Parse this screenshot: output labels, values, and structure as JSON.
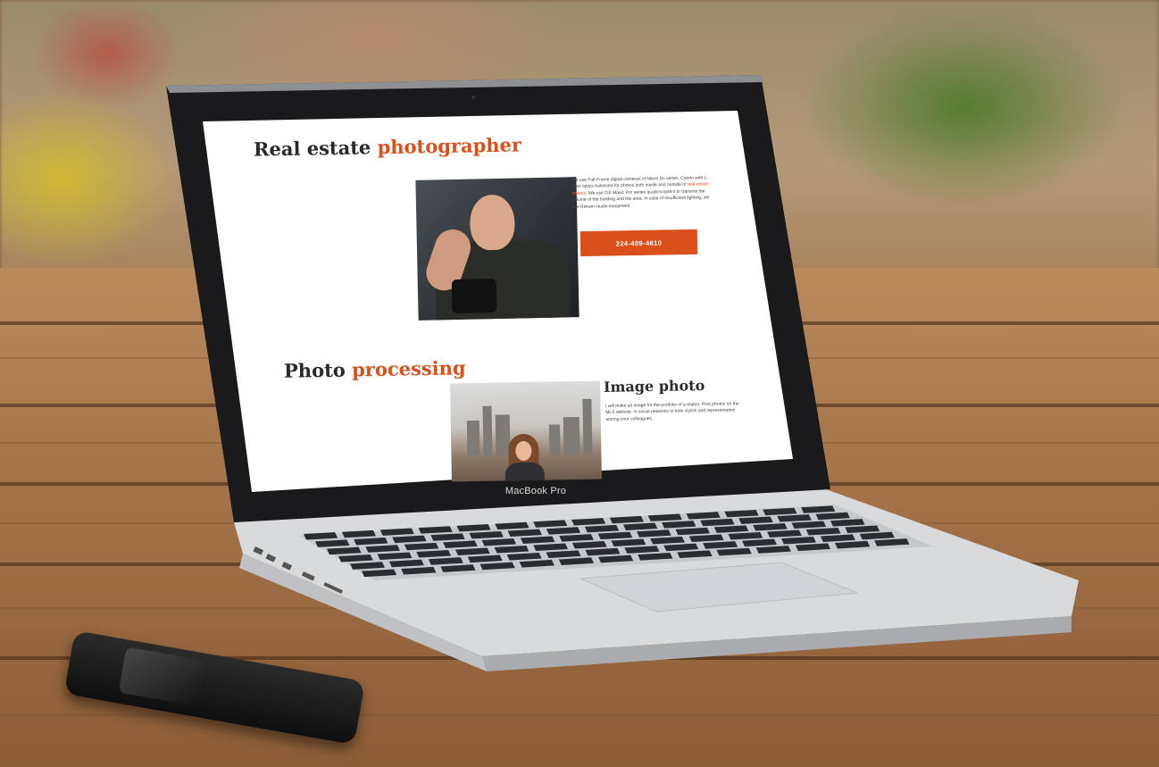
{
  "laptop": {
    "brand_label": "MacBook Pro"
  },
  "website": {
    "hero": {
      "title_plain": "Real estate ",
      "title_accent": "photographer",
      "description_part1": "We use Full-Frame digital cameras of Nikon Ds series, Canon with L-Glas optics balanced for photos both inside and outside of ",
      "description_link": "real estate objects",
      "description_part2": ". We use DJI Mavic Pro series quadrocopters to transmit the volume of the building and the area. In case of insufficient lighting, we use Rekam studio equipment",
      "phone_button": "224-409-4610"
    },
    "processing": {
      "title_plain": "Photo ",
      "title_accent": "processing"
    },
    "image_photo": {
      "title": "Image photo",
      "description": "I will make an image for the portfolio of a realtor. Post photos on the MLS website, in social networks to look stylish and representative among your colleagues."
    }
  },
  "colors": {
    "accent": "#d9501c",
    "heading": "#2a2a2a",
    "screen_background": "#ffffff"
  }
}
